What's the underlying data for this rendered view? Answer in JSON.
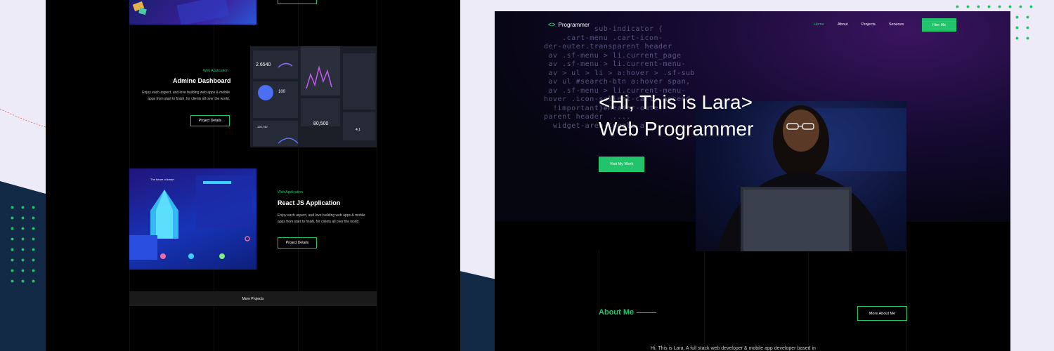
{
  "left_page": {
    "projects": [
      {
        "label": "Web Application",
        "title": "Admine Dashboard",
        "desc_line1": "Enjoy each aspect, and love building web apps & mobile",
        "desc_line2": "apps from start to finish, for clients all over the world.",
        "button": "Project Details"
      },
      {
        "label": "Web Application",
        "title": "React JS Application",
        "desc_line1": "Enjoy each aspect, and love building web apps & mobile",
        "desc_line2": "apps from start to finish, for clients all over the world.",
        "button": "Project Details"
      }
    ],
    "dashboard_stats": [
      "2.6540",
      "100",
      "80,500",
      "120,740",
      "4.1"
    ],
    "react_thumb_text": "The future of smart",
    "more_projects": "More Projects"
  },
  "right_page": {
    "nav": {
      "logo": "Programmer",
      "logo_icon": "<>",
      "links": [
        "Home",
        "About",
        "Projects",
        "Services"
      ],
      "hire_button": "Hire Me"
    },
    "code_lines": [
      "           sub-indicator {",
      "    .cart-menu .cart-icon-",
      "der-outer.transparent header",
      " av .sf-menu > li.current_page",
      " av .sf-menu > li.current-menu-",
      " av > ul > li > a:hover > .sf-sub",
      " av ul #search-btn a:hover span,",
      " av .sf-menu > li.current-menu-",
      "hover .icon-salient-cart,.ascend",
      "  !important}#header-outer",
      "parent header  ....",
      "  widget-area-toggle a"
    ],
    "hero": {
      "line1": "<Hi, This is Lara>",
      "line2": "Web Programmer",
      "button": "Visit My Work"
    },
    "about": {
      "title": "About Me",
      "button": "More About Me",
      "text": "Hi, This is Lara. A full stack web developer & mobile app developer based in"
    }
  },
  "colors": {
    "accent": "#21c46a",
    "background": "#ecebf7",
    "navy": "#132a46",
    "page": "#000000"
  }
}
